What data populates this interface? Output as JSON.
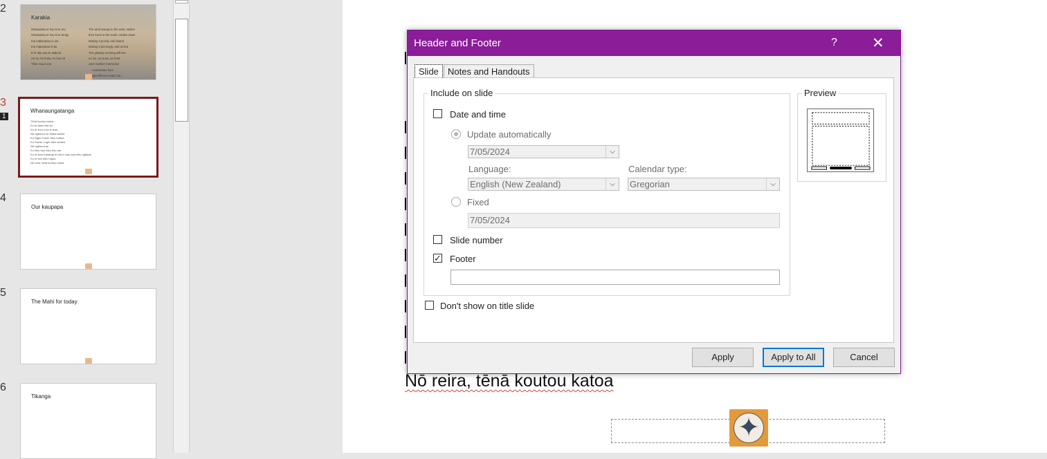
{
  "thumbnails": [
    {
      "num": "2",
      "title": "Karakia",
      "col1": "Whakataka te hau ki te uru\nWhakataka te hau ki te tonga\nKia mākinakina ki uta\nKia mātaratara ki tai\nE hī ake ana te atakura\nHe tio, he huka, he hau hū\nTīhei mauri ora!",
      "col2": "The wind swings to the west, settles\nthen turns to the south, settles down\nMaking it prickly cold inland\nMaking it piercingly cold at sea\nThe glowing morning will rise\non ice, on snow, on frost\nJoin! Gather! Intertwine!\n   ~ translation from\n   https://korero.maori.nz/..."
    },
    {
      "num": "3",
      "title": "Whanaungatanga",
      "lines": "Tēnā koutou katoa\nKo te Awa Hutt au\nKo te Kura Ura te awa\nNō ngāmoa nō Waka tauhie\nKo Nigel Foster tōku matua\nKo Suzan Luger tōku whaea\nNō ngāmoa au\nKo tōku tuoi tōku tino ara\nKo te Awa Kairangi ki Uta e mau ana tōku ngākau\nKo te tiori tōku ingoa\nNō reira, tēnā koutou katoa"
    },
    {
      "num": "4",
      "title": "Our kaupapa"
    },
    {
      "num": "5",
      "title": "The Mahi for today"
    },
    {
      "num": "6",
      "title": "Tikanga"
    }
  ],
  "active_badge": "1",
  "slide": {
    "closing_line": "Nō reira, tēnā koutou katoa"
  },
  "dialog": {
    "title": "Header and Footer",
    "help": "?",
    "close": "✕",
    "tabs": [
      "Slide",
      "Notes and Handouts"
    ],
    "include_group": "Include on slide",
    "date_time": {
      "label": "Date and time",
      "checked": false
    },
    "update_auto": {
      "label": "Update automatically",
      "selected": true
    },
    "date_value": "7/05/2024",
    "language_label": "Language:",
    "language_value": "English (New Zealand)",
    "calendar_label": "Calendar type:",
    "calendar_value": "Gregorian",
    "fixed": {
      "label": "Fixed",
      "selected": false
    },
    "fixed_value": "7/05/2024",
    "slide_number": {
      "label": "Slide number",
      "checked": false
    },
    "footer": {
      "label": "Footer",
      "checked": true,
      "value": ""
    },
    "dont_show": {
      "label": "Don't show on title slide",
      "checked": false
    },
    "preview_label": "Preview",
    "buttons": {
      "apply": "Apply",
      "apply_all": "Apply to All",
      "cancel": "Cancel"
    },
    "checkmark": "✓",
    "arrow": "⌵"
  },
  "colors": {
    "title_bar": "#8b1d99",
    "active_slide_border": "#7a1a1a",
    "focus": "#0078d7"
  }
}
